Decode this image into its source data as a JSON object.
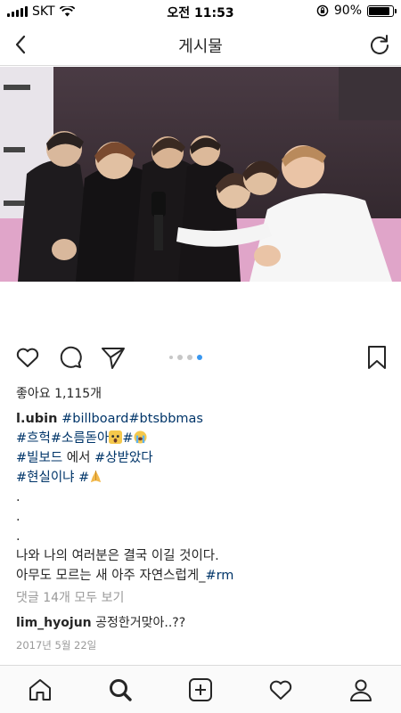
{
  "status_bar": {
    "carrier": "SKT",
    "time": "오전 11:53",
    "battery_percent": "90%",
    "battery_level": 0.9
  },
  "header": {
    "title": "게시물",
    "back_icon": "chevron-left-icon",
    "refresh_icon": "refresh-icon"
  },
  "post": {
    "photo_alt": "red carpet group photo with interviewer",
    "carousel": {
      "count": 4,
      "active_index": 3
    },
    "likes": "좋아요 1,115개",
    "caption": {
      "username": "l.ubin",
      "line1_tags": "#billboard#btsbbmas",
      "line2_tags": "#흐헉#소름돋아",
      "line2_tag_b": "#",
      "line3_text_a": "#빌보드",
      "line3_text_b": " 에서 ",
      "line3_tag": "#상받았다",
      "line4_tag_a": "#현실이냐",
      "line4_tag_b": " #",
      "dot1": ".",
      "dot2": ".",
      "dot3": ".",
      "line8": "나와 나의 여러분은 결국 이길 것이다.",
      "line9_text": "아무도 모르는 새 아주 자연스럽게_",
      "line9_tag": "#rm"
    },
    "view_comments": "댓글 14개 모두 보기",
    "comment": {
      "username": "lim_hyojun",
      "text": "공정한거맞아..??"
    },
    "date": "2017년 5월 22일"
  },
  "colors": {
    "hashtag": "#003569",
    "muted": "#999999",
    "text": "#262626",
    "active_dot": "#3897f0"
  }
}
